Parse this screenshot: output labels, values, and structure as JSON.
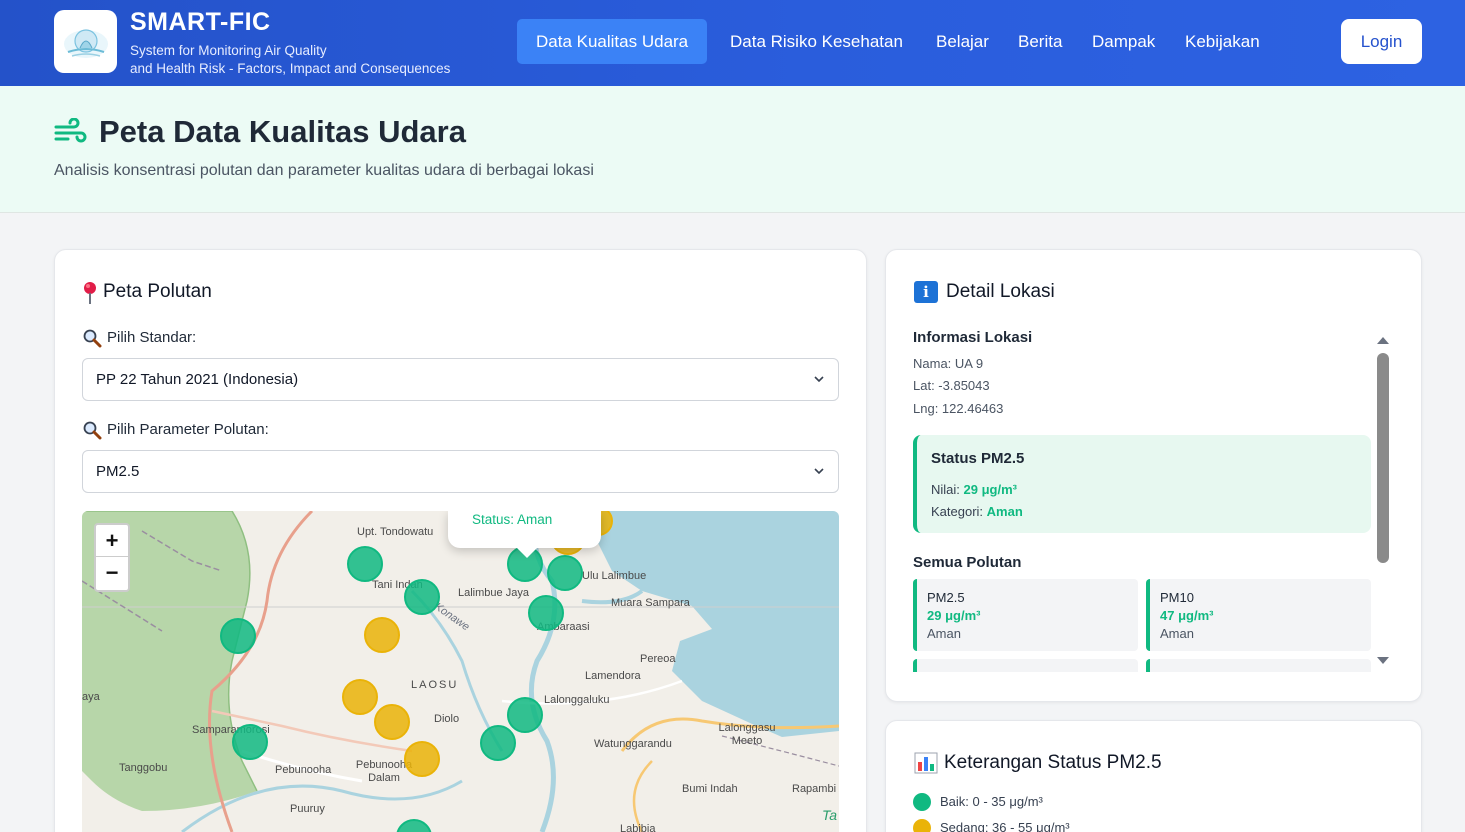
{
  "header": {
    "brand_title": "SMART-FIC",
    "brand_sub_line1": "System for Monitoring Air Quality",
    "brand_sub_line2": "and Health Risk - Factors, Impact and Consequences",
    "nav": [
      {
        "label": "Data Kualitas Udara",
        "active": true
      },
      {
        "label": "Data Risiko Kesehatan",
        "active": false
      },
      {
        "label": "Belajar",
        "active": false
      },
      {
        "label": "Berita",
        "active": false
      },
      {
        "label": "Dampak",
        "active": false
      },
      {
        "label": "Kebijakan",
        "active": false
      }
    ],
    "login_label": "Login"
  },
  "hero": {
    "icon": "wind-icon",
    "title": "Peta Data Kualitas Udara",
    "subtitle": "Analisis konsentrasi polutan dan parameter kualitas udara di berbagai lokasi"
  },
  "map_card": {
    "title": "Peta Polutan",
    "title_icon": "pushpin-icon",
    "standard_label": "Pilih Standar:",
    "standard_value": "PP 22 Tahun 2021 (Indonesia)",
    "parameter_label": "Pilih Parameter Polutan:",
    "parameter_value": "PM2.5",
    "zoom_in": "+",
    "zoom_out": "−",
    "popup_text": "Status: Aman",
    "place_labels": [
      "Upt. Tondowatu",
      "Tani Indah",
      "Lalimbue Jaya",
      "Ulu Lalimbue",
      "Muara Sampara",
      "Ambaraasi",
      "Konawe",
      "Pereoa",
      "Lamendora",
      "LAOSU",
      "Lalonggaluku",
      "aya",
      "Diolo",
      "Samparamorosi",
      "Lalonggasu Meeto",
      "Watunggarandu",
      "Tanggobu",
      "Pebunooha",
      "Pebunooha Dalam",
      "Bumi Indah",
      "Rapambi",
      "Puuruy",
      "Labibia"
    ],
    "colors": {
      "safe": "#10b981",
      "moderate": "#eab308"
    }
  },
  "detail_card": {
    "title": "Detail Lokasi",
    "title_icon": "info-icon",
    "info_heading": "Informasi Lokasi",
    "name_line": "Nama: UA 9",
    "lat_line": "Lat: -3.85043",
    "lng_line": "Lng: 122.46463",
    "status_title": "Status PM2.5",
    "value_label": "Nilai:",
    "value": "29 μg/m³",
    "category_label": "Kategori:",
    "category": "Aman",
    "all_heading": "Semua Polutan",
    "pollutants": [
      {
        "name": "PM2.5",
        "value": "29 μg/m³",
        "status": "Aman"
      },
      {
        "name": "PM10",
        "value": "47 μg/m³",
        "status": "Aman"
      }
    ]
  },
  "legend_card": {
    "title": "Keterangan Status PM2.5",
    "title_icon": "bar-chart-icon",
    "items": [
      {
        "label": "Baik: 0 - 35 μg/m³",
        "color": "#10b981"
      },
      {
        "label": "Sedang: 36 - 55 μg/m³",
        "color": "#eab308"
      }
    ]
  }
}
